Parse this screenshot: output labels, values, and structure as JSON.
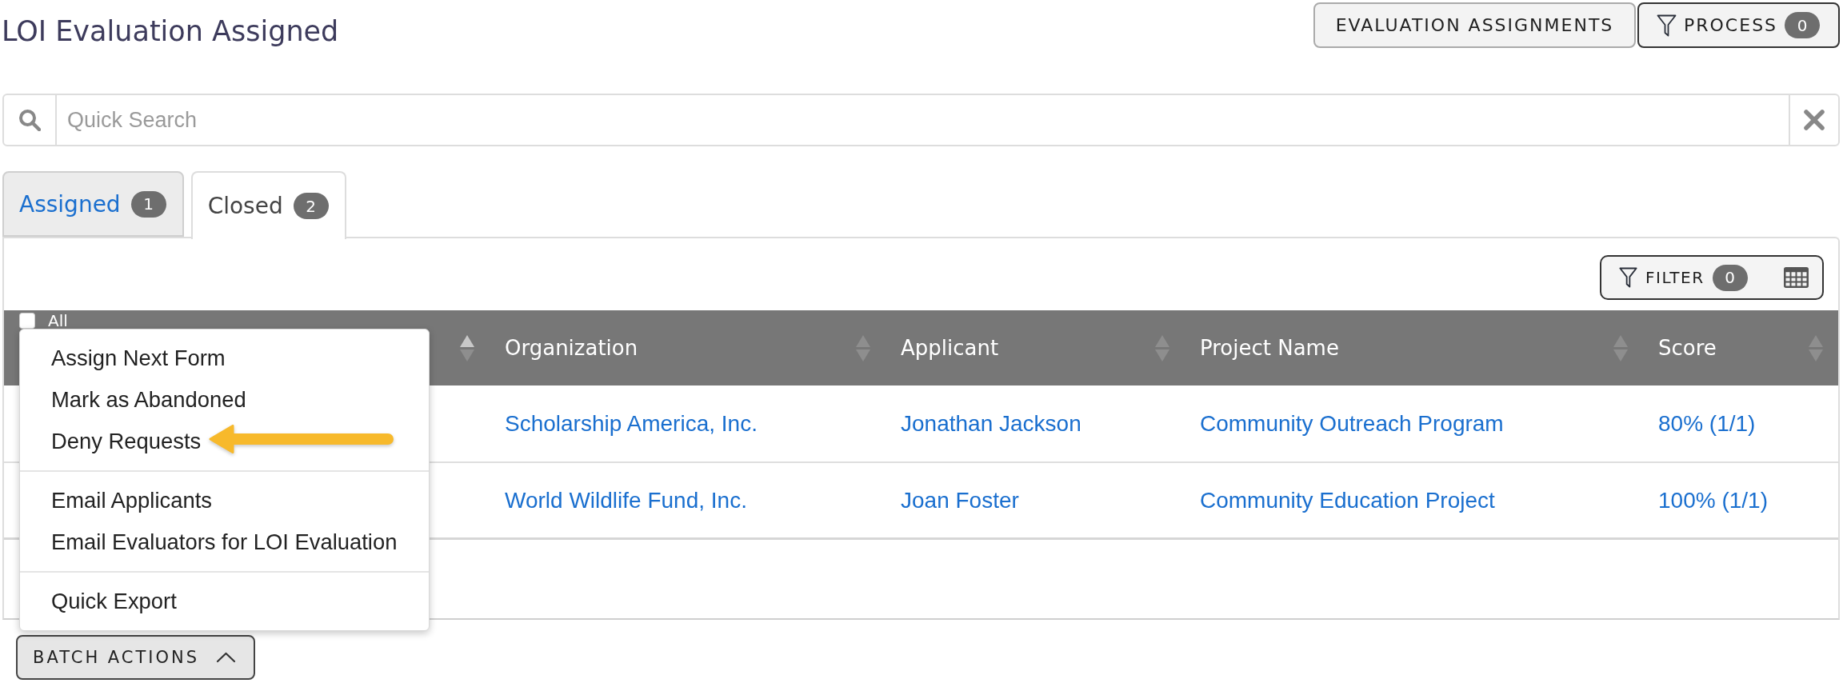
{
  "page": {
    "title": "LOI Evaluation Assigned"
  },
  "header_actions": {
    "assignments": {
      "label": "EVALUATION ASSIGNMENTS"
    },
    "process": {
      "label": "PROCESS",
      "count": "0"
    }
  },
  "search": {
    "placeholder": "Quick Search"
  },
  "tabs": [
    {
      "label": "Assigned",
      "count": "1",
      "selected": false
    },
    {
      "label": "Closed",
      "count": "2",
      "selected": true
    }
  ],
  "table_toolbar": {
    "filter": {
      "label": "FILTER",
      "count": "0"
    }
  },
  "table": {
    "columns": [
      {
        "kind": "select",
        "label": "All"
      },
      {
        "kind": "sortable",
        "sorted": true
      },
      {
        "kind": "sortable",
        "label": "Organization",
        "sorted": false
      },
      {
        "kind": "sortable",
        "label": "Applicant",
        "sorted": false
      },
      {
        "kind": "sortable",
        "label": "Project Name",
        "sorted": false
      },
      {
        "kind": "sortable",
        "label": "Score",
        "sorted": false
      }
    ],
    "rows": [
      {
        "cells": [
          "",
          "",
          "Scholarship America, Inc.",
          "Jonathan Jackson",
          "Community Outreach Program",
          "80% (1/1)"
        ]
      },
      {
        "cells": [
          "",
          "",
          "World Wildlife Fund, Inc.",
          "Joan Foster",
          "Community Education Project",
          "100% (1/1)"
        ]
      }
    ]
  },
  "batch_actions": {
    "label": "BATCH ACTIONS",
    "expanded": true,
    "menu_sections": [
      {
        "items": [
          {
            "label": "Assign Next Form",
            "annotated": false
          },
          {
            "label": "Mark as Abandoned",
            "annotated": false
          },
          {
            "label": "Deny Requests",
            "annotated": true
          }
        ]
      },
      {
        "items": [
          {
            "label": "Email Applicants",
            "annotated": false
          },
          {
            "label": "Email Evaluators for LOI Evaluation",
            "annotated": false
          }
        ]
      },
      {
        "items": [
          {
            "label": "Quick Export",
            "annotated": false
          }
        ]
      }
    ]
  }
}
